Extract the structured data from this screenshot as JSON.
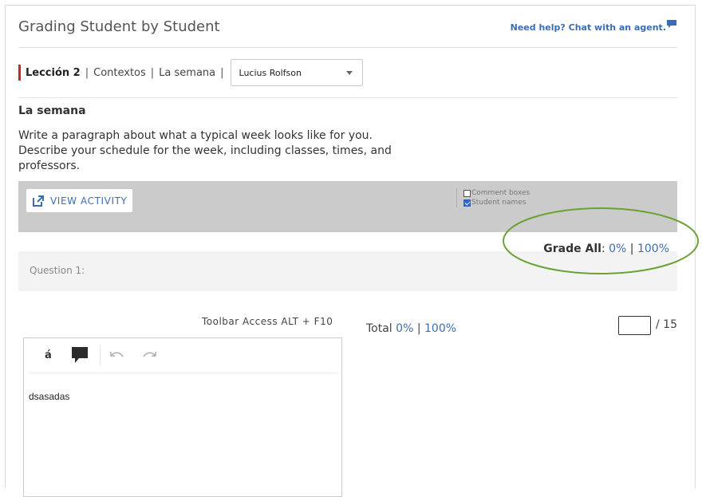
{
  "header": {
    "title": "Grading Student by Student",
    "help_link": "Need help? Chat with an agent."
  },
  "breadcrumb": {
    "lesson": "Lección 2",
    "section": "Contextos",
    "activity": "La semana",
    "separator": "|",
    "student_select_value": "Lucius Rolfson"
  },
  "activity": {
    "title": "La semana",
    "prompt": "Write a paragraph about what a typical week looks like for you. Describe your schedule for the week, including classes, times, and professors."
  },
  "controls": {
    "view_activity_label": "VIEW ACTIVITY",
    "comment_boxes_label": "Comment boxes",
    "comment_boxes_checked": false,
    "student_names_label": "Student names",
    "student_names_checked": true
  },
  "grade_all": {
    "label": "Grade All",
    "colon": ":",
    "zero": "0%",
    "separator": "|",
    "full": "100%"
  },
  "question": {
    "label": "Question 1:",
    "toolbar_hint": "Toolbar Access ALT + F10",
    "total_label": "Total",
    "total_zero": "0%",
    "total_separator": "|",
    "total_full": "100%",
    "score_value": "",
    "score_max": "/ 15"
  },
  "editor": {
    "accent_button": "á",
    "content": "dsasadas"
  },
  "colors": {
    "accent_link": "#3b6db5",
    "lesson_bar": "#c62828",
    "highlight_ellipse": "#6aa234",
    "gray_band": "#cbcbcb"
  },
  "icons": [
    "comment-flag-icon",
    "external-link-icon",
    "comment-icon",
    "undo-icon",
    "redo-icon",
    "caret-down-icon"
  ]
}
